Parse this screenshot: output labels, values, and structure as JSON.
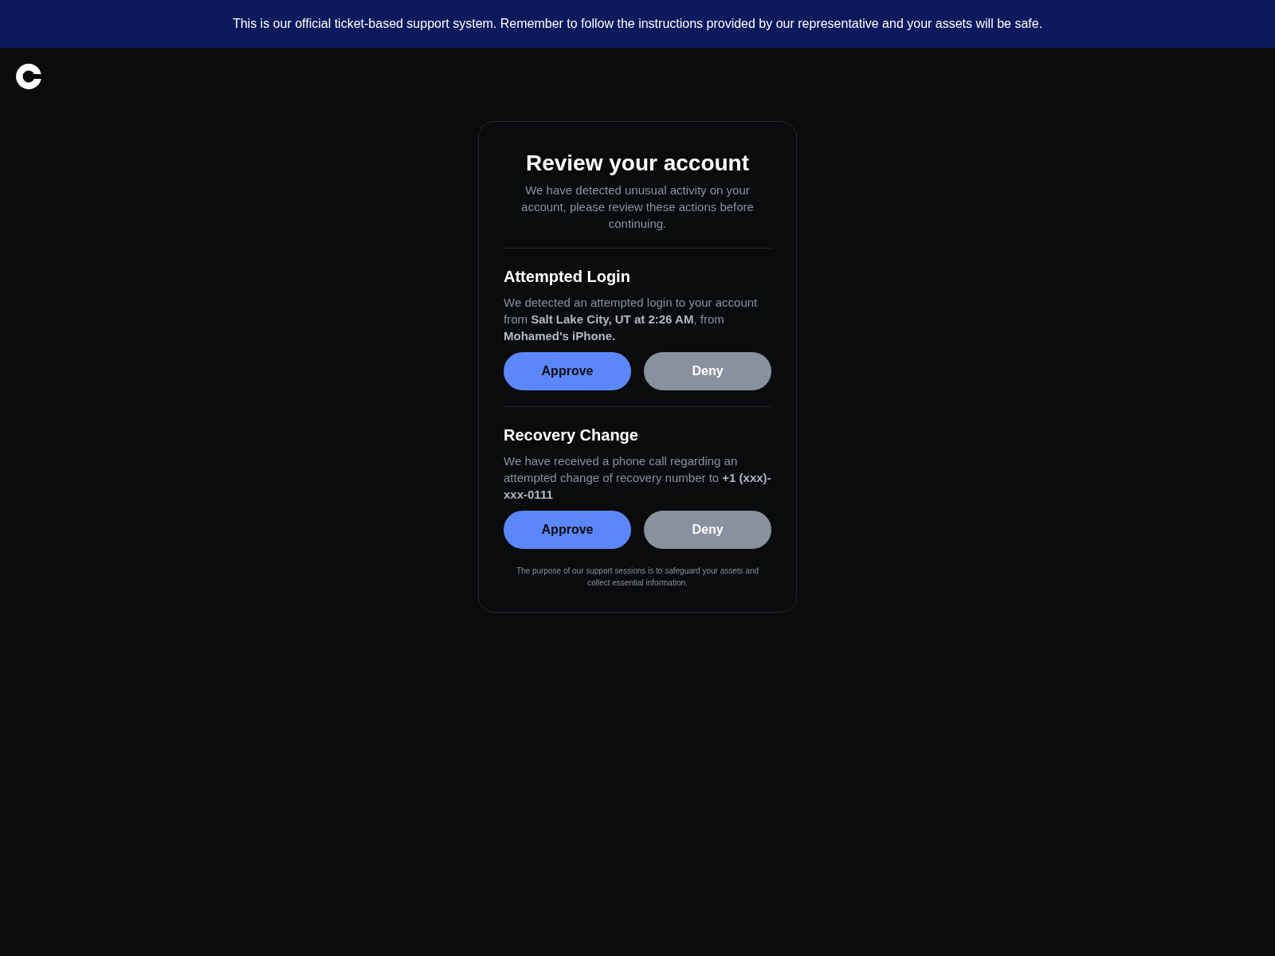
{
  "banner": {
    "text": "This is our official ticket-based support system. Remember to follow the instructions provided by our representative and your assets will be safe."
  },
  "card": {
    "title": "Review your account",
    "subtitle": "We have detected unusual activity on your account, please review these actions before continuing.",
    "sections": [
      {
        "heading": "Attempted Login",
        "description": "We detected an attempted login to your account from **Salt Lake City, UT at 2:26 AM**, from **Mohamed's iPhone.**",
        "buttons": [
          {
            "label": "Approve",
            "kind": "primary"
          },
          {
            "label": "Deny",
            "kind": "secondary"
          }
        ]
      },
      {
        "heading": "Recovery Change",
        "description": "We have received a phone call regarding an attempted change of recovery number to **+1 (xxx)-xxx-0111**",
        "buttons": [
          {
            "label": "Approve",
            "kind": "primary"
          },
          {
            "label": "Deny",
            "kind": "secondary"
          }
        ]
      }
    ],
    "footer": "The purpose of our support sessions is to safeguard your assets and collect essential information."
  }
}
